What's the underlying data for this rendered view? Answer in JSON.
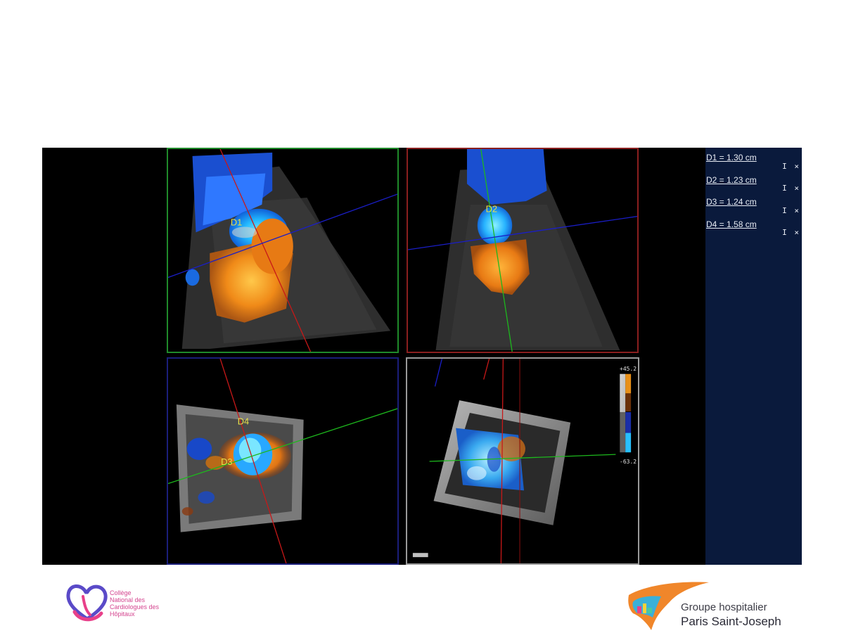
{
  "measurements": [
    {
      "label": "D1 = 1.30 cm",
      "controls": "I ×"
    },
    {
      "label": "D2 = 1.23 cm",
      "controls": "I ×"
    },
    {
      "label": "D3 = 1.24 cm",
      "controls": "I ×"
    },
    {
      "label": "D4 = 1.58 cm",
      "controls": "I ×"
    }
  ],
  "markers": {
    "d1": "D1",
    "d2": "D2",
    "d3": "D3",
    "d4": "D4"
  },
  "color_scale": {
    "max": "+45.2",
    "min": "-63.2"
  },
  "logos": {
    "left": {
      "lines": [
        "Collège",
        "National des",
        "Cardiologues des",
        "Hôpitaux"
      ]
    },
    "right": {
      "line1": "Groupe hospitalier",
      "line2": "Paris Saint-Joseph"
    }
  },
  "colors": {
    "panel_bg": "#0a1a3c",
    "marker_yellow": "#e8e04a",
    "doppler_blue": "#1a78ff",
    "doppler_orange": "#ff8a1a"
  }
}
